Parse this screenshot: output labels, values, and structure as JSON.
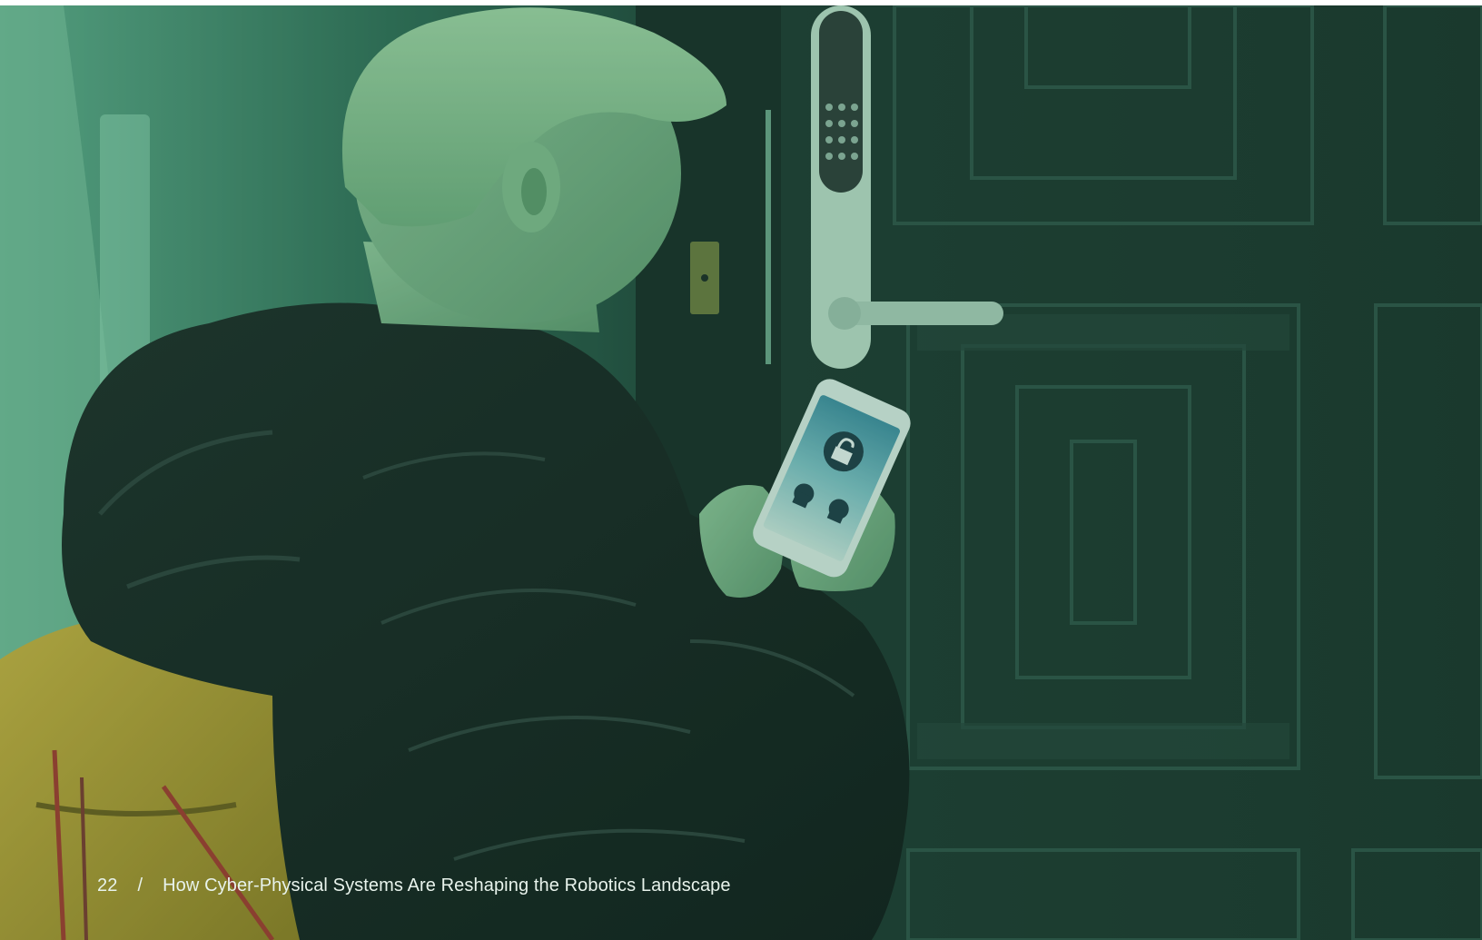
{
  "footer": {
    "page_number": "22",
    "separator": "/",
    "title": "How Cyber-Physical Systems Are Reshaping the Robotics Landscape"
  },
  "photo": {
    "description_icon": "photo-child-unlocking-smart-door-lock",
    "tint": "#1f5a44"
  }
}
